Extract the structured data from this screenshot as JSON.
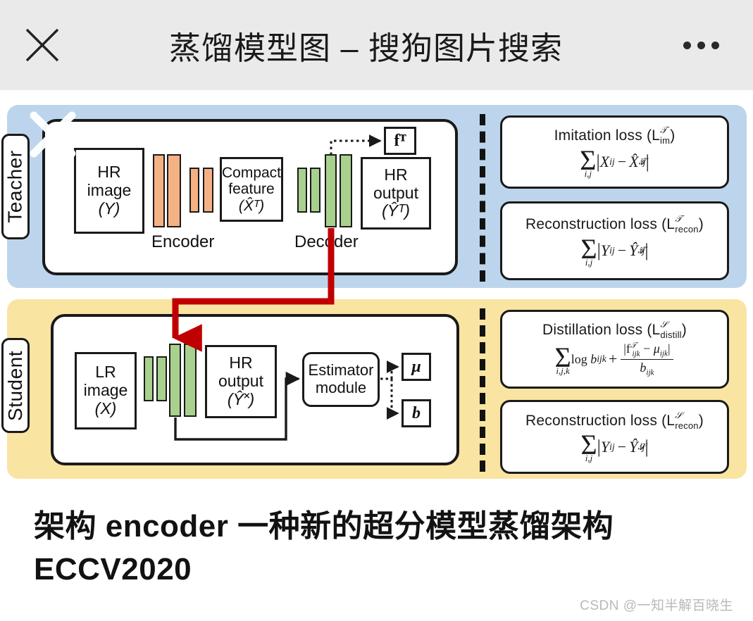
{
  "header": {
    "title": "蒸馏模型图 – 搜狗图片搜索",
    "close_icon": "close-x-icon",
    "more_icon": "more-dots-icon"
  },
  "figure": {
    "teacher": {
      "side_label": "Teacher",
      "nodes": {
        "input": {
          "line1": "HR",
          "line2": "image",
          "line3": "(Y)"
        },
        "compact": {
          "line1": "Compact",
          "line2": "feature",
          "line3": "(X̂ᵀ)"
        },
        "output": {
          "line1": "HR",
          "line2": "output",
          "line3": "(Ŷᵀ)"
        },
        "feature_tap": "fᵀ"
      },
      "encoder_label": "Encoder",
      "decoder_label": "Decoder"
    },
    "student": {
      "side_label": "Student",
      "nodes": {
        "input": {
          "line1": "LR",
          "line2": "image",
          "line3": "(X)"
        },
        "output": {
          "line1": "HR",
          "line2": "output",
          "line3": "(Ŷ˟)"
        },
        "estimator": {
          "line1": "Estimator",
          "line2": "module"
        },
        "mu": "μ",
        "b": "b"
      }
    },
    "losses": {
      "teacher": [
        {
          "title": "Imitation loss (L",
          "title_sub": "im",
          "title_sup": "𝒯",
          "title_end": ")",
          "equation": "Σ_{i,j} |X_ij − X̂ᵀ_ij|"
        },
        {
          "title": "Reconstruction loss (L",
          "title_sub": "recon",
          "title_sup": "𝒯",
          "title_end": ")",
          "equation": "Σ_{i,j} |Y_ij − Ŷᵀ_ij|"
        }
      ],
      "student": [
        {
          "title": "Distillation loss (L",
          "title_sub": "distill",
          "title_sup": "𝒮",
          "title_end": ")",
          "equation": "Σ_{i,j,k} log b_ijk + |fᵀ_ijk − μ_ijk| / b_ijk"
        },
        {
          "title": "Reconstruction loss (L",
          "title_sub": "recon",
          "title_sup": "𝒮",
          "title_end": ")",
          "equation": "Σ_{i,j} |Y_ij − Ŷ˟_ij|"
        }
      ]
    },
    "colors": {
      "teacher_panel": "#bdd5ec",
      "student_panel": "#fae4a2",
      "encoder_block": "#f4b183",
      "decoder_block": "#a9d18e",
      "distill_arrow": "#c00000",
      "header_bg": "#eaeaea"
    }
  },
  "caption": {
    "text": "架构 encoder 一种新的超分模型蒸馏架构 ECCV2020",
    "watermark": "CSDN @一知半解百晓生"
  }
}
